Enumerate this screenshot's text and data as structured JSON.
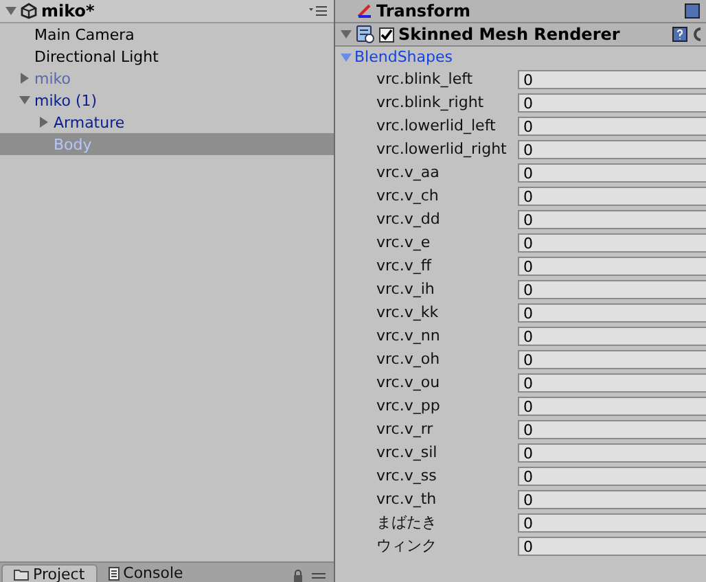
{
  "hierarchy": {
    "scene": {
      "name": "miko*",
      "expanded": true
    },
    "items": [
      {
        "label": "Main Camera",
        "prefab": false,
        "active": true,
        "selected": false
      },
      {
        "label": "Directional Light",
        "prefab": false,
        "active": true,
        "selected": false
      },
      {
        "label": "miko",
        "prefab": true,
        "active": false,
        "selected": false,
        "expanded": false
      },
      {
        "label": "miko (1)",
        "prefab": true,
        "active": true,
        "selected": false,
        "expanded": true,
        "children": [
          {
            "label": "Armature",
            "prefab": true,
            "active": true,
            "selected": false,
            "expanded": false
          },
          {
            "label": "Body",
            "prefab": true,
            "active": true,
            "selected": true
          }
        ]
      }
    ]
  },
  "bottom_tabs": [
    {
      "label": "Project",
      "selected": true
    },
    {
      "label": "Console",
      "selected": false
    }
  ],
  "inspector": {
    "transform": {
      "title": "Transform"
    },
    "component": {
      "title": "Skinned Mesh Renderer",
      "enabled": true,
      "expanded": true
    },
    "blend_shapes": {
      "label": "BlendShapes",
      "expanded": true,
      "rows": [
        {
          "name": "vrc.blink_left",
          "value": "0"
        },
        {
          "name": "vrc.blink_right",
          "value": "0"
        },
        {
          "name": "vrc.lowerlid_left",
          "value": "0"
        },
        {
          "name": "vrc.lowerlid_right",
          "value": "0"
        },
        {
          "name": "vrc.v_aa",
          "value": "0"
        },
        {
          "name": "vrc.v_ch",
          "value": "0"
        },
        {
          "name": "vrc.v_dd",
          "value": "0"
        },
        {
          "name": "vrc.v_e",
          "value": "0"
        },
        {
          "name": "vrc.v_ff",
          "value": "0"
        },
        {
          "name": "vrc.v_ih",
          "value": "0"
        },
        {
          "name": "vrc.v_kk",
          "value": "0"
        },
        {
          "name": "vrc.v_nn",
          "value": "0"
        },
        {
          "name": "vrc.v_oh",
          "value": "0"
        },
        {
          "name": "vrc.v_ou",
          "value": "0"
        },
        {
          "name": "vrc.v_pp",
          "value": "0"
        },
        {
          "name": "vrc.v_rr",
          "value": "0"
        },
        {
          "name": "vrc.v_sil",
          "value": "0"
        },
        {
          "name": "vrc.v_ss",
          "value": "0"
        },
        {
          "name": "vrc.v_th",
          "value": "0"
        },
        {
          "name": "まばたき",
          "value": "0"
        },
        {
          "name": "ウィンク",
          "value": "0"
        }
      ]
    }
  }
}
